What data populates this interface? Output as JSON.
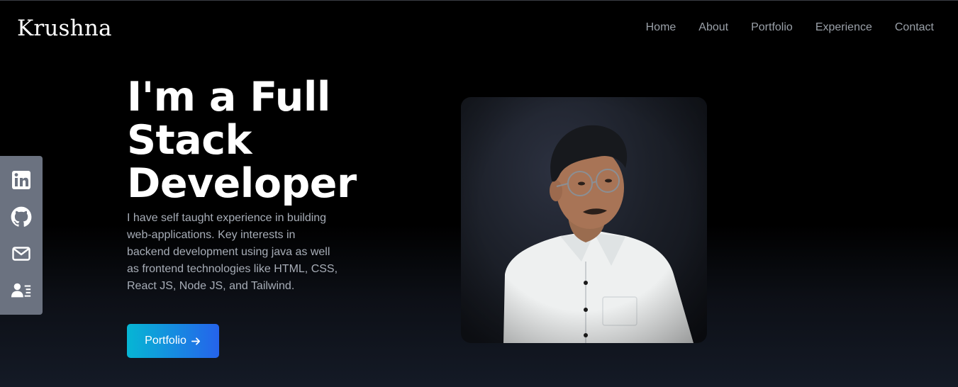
{
  "brand": {
    "logo": "Krushna"
  },
  "nav": {
    "items": [
      "Home",
      "About",
      "Portfolio",
      "Experience",
      "Contact"
    ]
  },
  "social": {
    "icons": [
      "linkedin-icon",
      "github-icon",
      "mail-icon",
      "resume-icon"
    ]
  },
  "hero": {
    "title_lines": [
      "I'm a Full",
      "Stack",
      "Developer"
    ],
    "description": "I have self taught experience in building web-applications. Key interests in backend development using java as well as frontend technologies like HTML, CSS, React JS, Node JS, and Tailwind.",
    "cta_label": "Portfolio",
    "cta_icon": "arrow-right-icon"
  },
  "colors": {
    "accent_start": "#06b6d4",
    "accent_end": "#2563eb",
    "nav_text": "#9aa0a8",
    "social_bar": "#6b7280"
  }
}
